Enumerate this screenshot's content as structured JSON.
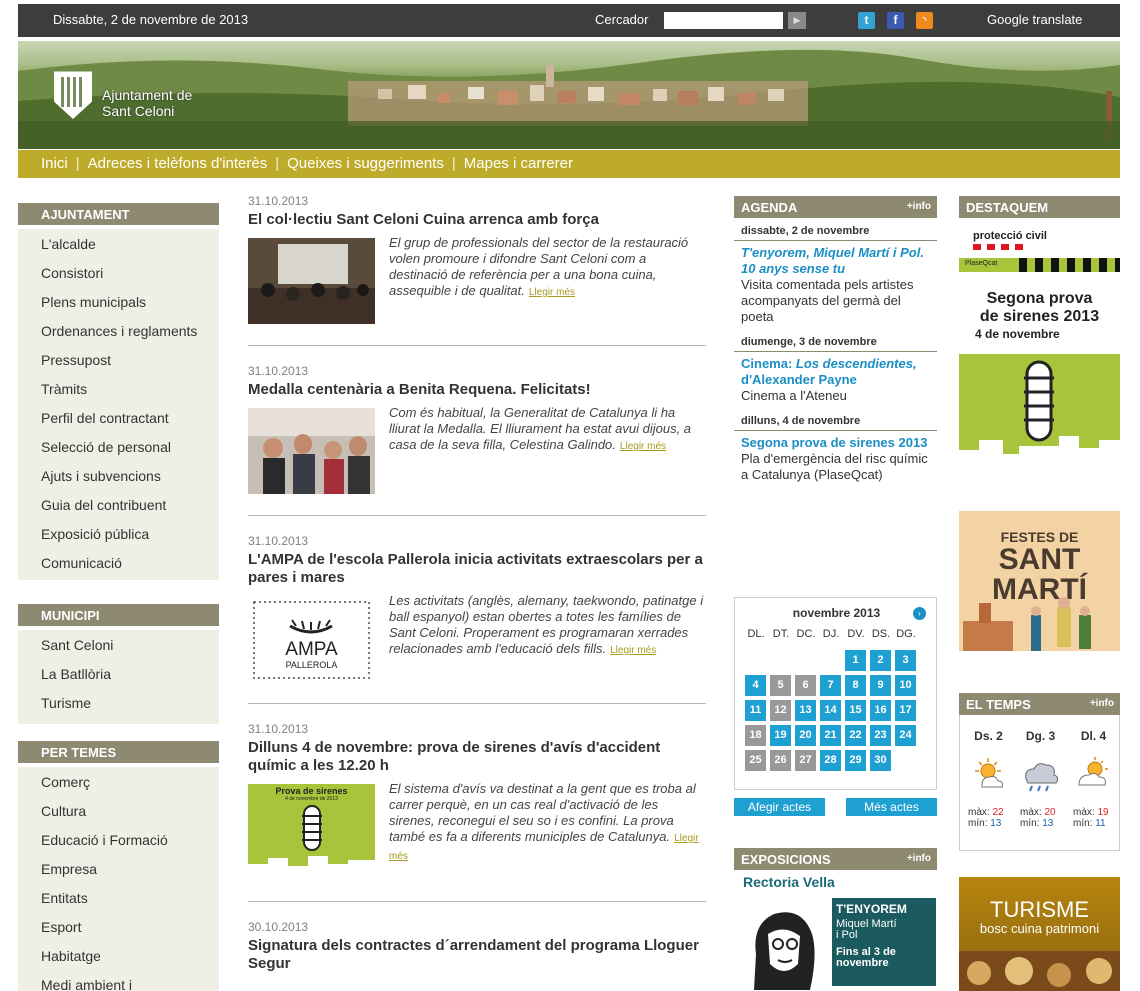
{
  "topbar": {
    "date": "Dissabte, 2 de novembre de 2013",
    "search_label": "Cercador",
    "search_value": "",
    "twitter": "t",
    "facebook": "f",
    "rss": "rss",
    "translate": "Google translate"
  },
  "logo": {
    "line1": "Ajuntament de",
    "line2": "Sant Celoni"
  },
  "nav": {
    "items": [
      "Inici",
      "Adreces i telèfons d'interès",
      "Queixes i suggeriments",
      "Mapes i carrerer"
    ]
  },
  "sidebar": {
    "ajuntament": {
      "title": "AJUNTAMENT",
      "items": [
        "L'alcalde",
        "Consistori",
        "Plens municipals",
        "Ordenances i reglaments",
        "Pressupost",
        "Tràmits",
        "Perfil del contractant",
        "Selecció de personal",
        "Ajuts i subvencions",
        "Guia del contribuent",
        "Exposició pública",
        "Comunicació"
      ]
    },
    "municipi": {
      "title": "MUNICIPI",
      "items": [
        "Sant Celoni",
        "La Batllòria",
        "Turisme"
      ]
    },
    "per_temes": {
      "title": "PER TEMES",
      "items": [
        "Comerç",
        "Cultura",
        "Educació i Formació",
        "Empresa",
        "Entitats",
        "Esport",
        "Habitatge",
        "Medi ambient i"
      ]
    }
  },
  "news": {
    "more": "Llegir més",
    "articles": [
      {
        "date": "31.10.2013",
        "title": "El col·lectiu Sant Celoni Cuina arrenca amb força",
        "text": "El grup de professionals del sector de la restauració volen promoure i difondre Sant Celoni com a destinació de referència per a una bona cuina, assequible i de qualitat."
      },
      {
        "date": "31.10.2013",
        "title": "Medalla centenària a Benita Requena. Felicitats!",
        "text": "Com és habitual, la Generalitat de Catalunya li ha lliurat la Medalla. El lliurament ha estat avui dijous, a casa de la seva filla, Celestina Galindo."
      },
      {
        "date": "31.10.2013",
        "title": "L'AMPA de l'escola Pallerola inicia activitats extraescolars per a pares i mares",
        "text": "Les activitats (anglès, alemany, taekwondo, patinatge i ball espanyol) estan obertes a totes les famílies de Sant Celoni. Properament es programaran xerrades relacionades amb l'educació dels fills.",
        "thumb_line1": "AMPA",
        "thumb_line2": "PALLEROLA"
      },
      {
        "date": "31.10.2013",
        "title": "Dilluns 4 de novembre:  prova de sirenes d'avís d'accident químic a les 12.20 h",
        "text": "El sistema d'avís va destinat a la gent que es troba al carrer perquè, en un cas real d'activació de les sirenes, reconegui el seu so i es confini. La prova també es fa a diferents municiples de Catalunya.",
        "thumb_line1": "Prova de sirenes",
        "thumb_line2": "4 de novembre de 2013"
      },
      {
        "date": "30.10.2013",
        "title": "Signatura dels contractes d´arrendament del programa Lloguer Segur"
      }
    ]
  },
  "agenda": {
    "title": "AGENDA",
    "more": "+info",
    "days": [
      {
        "day": "dissabte, 2 de novembre",
        "events": [
          {
            "title": "T'enyorem, Miquel Martí i Pol. 10 anys sense tu",
            "desc": "Visita comentada pels artistes acompanyats del germà del poeta"
          }
        ]
      },
      {
        "day": "diumenge, 3 de novembre",
        "events": [
          {
            "title_prefix": "Cinema: ",
            "title": "Los descendientes,",
            "title_suffix": "d'Alexander Payne",
            "desc": "Cinema a l'Ateneu"
          }
        ]
      },
      {
        "day": "dilluns, 4 de novembre",
        "events": [
          {
            "title": "Segona prova de sirenes 2013",
            "desc": "Pla d'emergència del risc químic a Catalunya (PlaseQcat)"
          }
        ]
      }
    ]
  },
  "calendar": {
    "month": "novembre 2013",
    "next": "›",
    "weekdays": [
      "DL.",
      "DT.",
      "DC.",
      "DJ.",
      "DV.",
      "DS.",
      "DG."
    ],
    "days": [
      {
        "d": "1",
        "c": "b"
      },
      {
        "d": "2",
        "c": "b"
      },
      {
        "d": "3",
        "c": "b"
      },
      {
        "d": "4",
        "c": "b"
      },
      {
        "d": "5",
        "c": "g"
      },
      {
        "d": "6",
        "c": "g"
      },
      {
        "d": "7",
        "c": "b"
      },
      {
        "d": "8",
        "c": "b"
      },
      {
        "d": "9",
        "c": "b"
      },
      {
        "d": "10",
        "c": "b"
      },
      {
        "d": "11",
        "c": "b"
      },
      {
        "d": "12",
        "c": "g"
      },
      {
        "d": "13",
        "c": "b"
      },
      {
        "d": "14",
        "c": "b"
      },
      {
        "d": "15",
        "c": "b"
      },
      {
        "d": "16",
        "c": "b"
      },
      {
        "d": "17",
        "c": "b"
      },
      {
        "d": "18",
        "c": "g"
      },
      {
        "d": "19",
        "c": "b"
      },
      {
        "d": "20",
        "c": "b"
      },
      {
        "d": "21",
        "c": "b"
      },
      {
        "d": "22",
        "c": "b"
      },
      {
        "d": "23",
        "c": "b"
      },
      {
        "d": "24",
        "c": "b"
      },
      {
        "d": "25",
        "c": "g"
      },
      {
        "d": "26",
        "c": "g"
      },
      {
        "d": "27",
        "c": "g"
      },
      {
        "d": "28",
        "c": "b"
      },
      {
        "d": "29",
        "c": "b"
      },
      {
        "d": "30",
        "c": "b"
      }
    ],
    "add_button": "Afegir actes",
    "more_button": "Més actes"
  },
  "expo": {
    "title": "EXPOSICIONS",
    "more": "+info",
    "venue": "Rectoria Vella",
    "card_title": "T'ENYOREM",
    "card_l1": "Miquel Martí",
    "card_l2": "i Pol",
    "card_l3": "Fins al 3 de",
    "card_l4": "novembre"
  },
  "destaquem": {
    "title": "DESTAQUEM",
    "sirens_brand": "protecció civil",
    "sirens_brand2": "PlaseQcat",
    "sirens_l1": "Segona prova",
    "sirens_l2": "de sirenes 2013",
    "sirens_l3": "4 de novembre",
    "festes_l1": "FESTES DE",
    "festes_l2": "SANT",
    "festes_l3": "MARTÍ"
  },
  "weather": {
    "title": "EL TEMPS",
    "more": "+info",
    "max_label": "màx:",
    "min_label": "mín:",
    "days": [
      {
        "day": "Ds. 2",
        "max": "22",
        "min": "13"
      },
      {
        "day": "Dg. 3",
        "max": "20",
        "min": "13"
      },
      {
        "day": "Dl. 4",
        "max": "19",
        "min": "11"
      }
    ]
  },
  "turisme": {
    "title": "TURISME",
    "sub": "bosc cuina patrimoni"
  },
  "colors": {
    "nav": "#bfab2a",
    "box_header": "#8e8971",
    "link_blue": "#1a8fc4",
    "calendar_blue": "#1fa0d2"
  }
}
